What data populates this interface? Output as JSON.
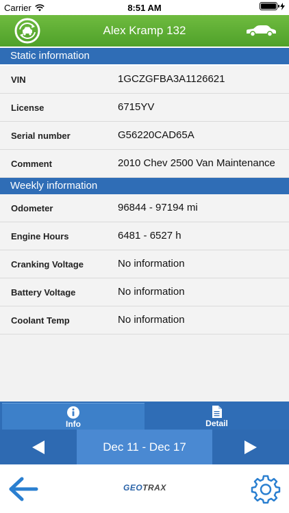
{
  "status_bar": {
    "carrier": "Carrier",
    "time": "8:51 AM",
    "battery_level": 1.0
  },
  "header": {
    "title": "Alex Kramp 132"
  },
  "static_section": {
    "title": "Static information",
    "rows": [
      {
        "label": "VIN",
        "value": "1GCZGFBA3A1126621"
      },
      {
        "label": "License",
        "value": "6715YV"
      },
      {
        "label": "Serial number",
        "value": "G56220CAD65A"
      },
      {
        "label": "Comment",
        "value": "2010 Chev 2500 Van Maintenance"
      }
    ]
  },
  "weekly_section": {
    "title": "Weekly information",
    "rows": [
      {
        "label": "Odometer",
        "value": "96844 - 97194 mi"
      },
      {
        "label": "Engine Hours",
        "value": "6481 - 6527 h"
      },
      {
        "label": "Cranking Voltage",
        "value": "No information"
      },
      {
        "label": "Battery Voltage",
        "value": "No information"
      },
      {
        "label": "Coolant Temp",
        "value": "No information"
      }
    ]
  },
  "tabs": [
    {
      "label": "Info",
      "icon": "info-icon",
      "selected": true
    },
    {
      "label": "Detail",
      "icon": "document-icon",
      "selected": false
    }
  ],
  "week_nav": {
    "label": "Dec 11 - Dec 17"
  },
  "toolbar": {
    "logo_part1": "GEO",
    "logo_part2": "TRAX"
  },
  "colors": {
    "header_green": "#5aab33",
    "section_blue": "#2f6db6",
    "accent_blue": "#2a7fd0"
  }
}
